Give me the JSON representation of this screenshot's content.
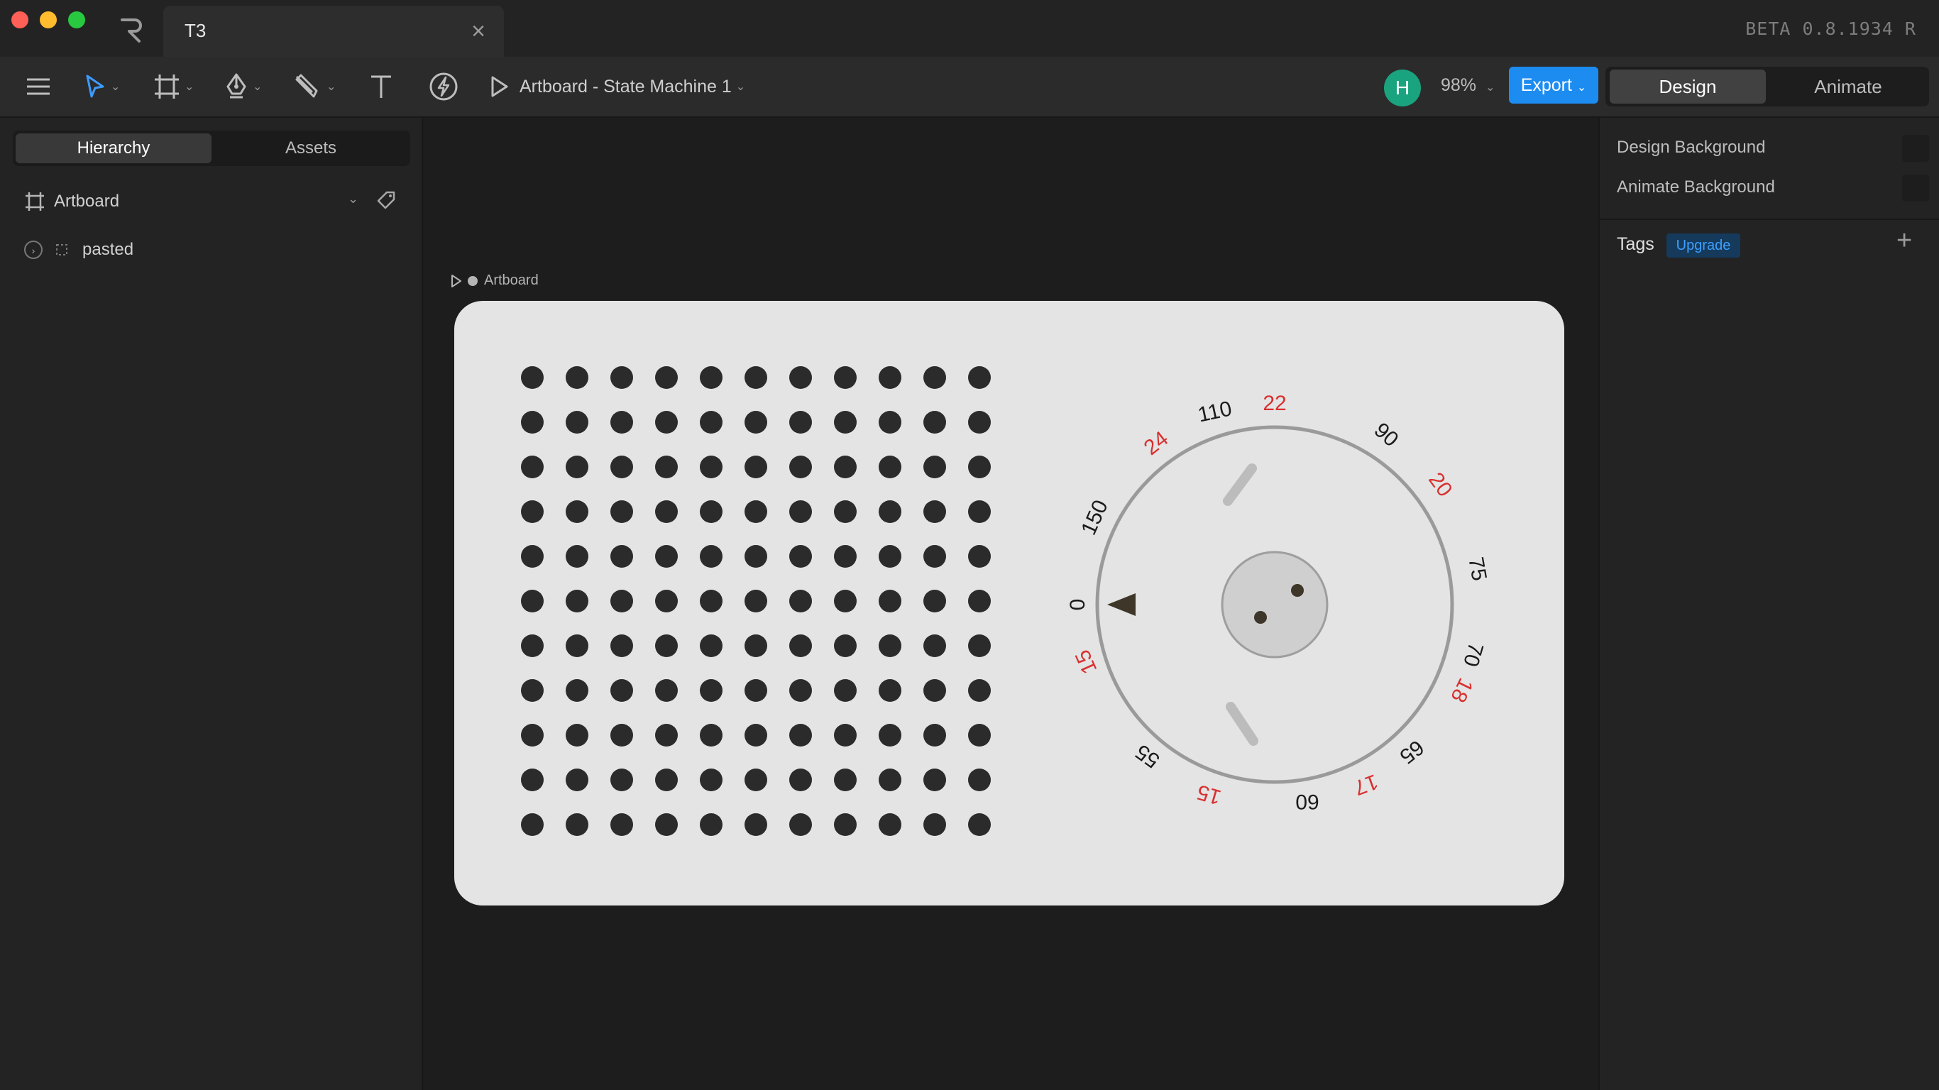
{
  "window": {
    "tab_title": "T3",
    "version": "BETA 0.8.1934 R"
  },
  "toolbar": {
    "artboard_selector": "Artboard - State Machine 1",
    "avatar_initial": "H",
    "zoom": "98%",
    "export_label": "Export",
    "mode_design": "Design",
    "mode_animate": "Animate"
  },
  "left_panel": {
    "tab_hierarchy": "Hierarchy",
    "tab_assets": "Assets",
    "tree": {
      "artboard": "Artboard",
      "pasted": "pasted"
    }
  },
  "canvas": {
    "artboard_label": "Artboard",
    "speaker_grid": {
      "rows": 11,
      "cols": 11
    },
    "dial": {
      "outer_labels": [
        "110",
        "90",
        "75",
        "70",
        "65",
        "60",
        "55",
        "150",
        "0"
      ],
      "inner_labels": [
        "22",
        "24",
        "20",
        "18",
        "17",
        "15",
        "15"
      ]
    }
  },
  "right_panel": {
    "design_background": "Design Background",
    "animate_background": "Animate Background",
    "tags": "Tags",
    "upgrade": "Upgrade"
  },
  "colors": {
    "accent": "#1d8cf0",
    "avatar": "#1aa37f",
    "artboard_bg": "#e4e4e4",
    "dot": "#2b2b2b",
    "dial_red": "#d93030"
  }
}
